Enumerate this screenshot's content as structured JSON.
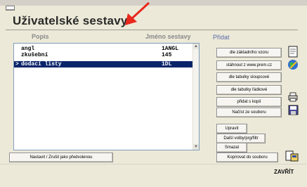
{
  "window": {
    "title": "Uživatelské sestavy"
  },
  "list": {
    "col_popis": "Popis",
    "col_jmeno": "Jméno sestavy",
    "rows": [
      {
        "marker": "",
        "name": "angl",
        "code": "1ANGL",
        "selected": false
      },
      {
        "marker": "",
        "name": "zkušební",
        "code": "145",
        "selected": false
      },
      {
        "marker": ">",
        "name": "dodací listy",
        "code": "1DL",
        "selected": true
      }
    ]
  },
  "add_panel": {
    "label": "Přidat",
    "buttons": {
      "from_template": "dle základního vzoru",
      "download": "stáhnout z www.prem.cz",
      "by_column_table": "dle tabulky sloupcové",
      "by_row_table": "dle tabulky řádkové",
      "add_copy": "přidat s kopií",
      "load_file": "Načíst ze souboru"
    }
  },
  "edit_panel": {
    "buttons": {
      "edit": "Upravit",
      "more_options": "Další volby/prg/filtr",
      "delete": "Smazat",
      "copy_to_file": "Kopírovat do souboru"
    }
  },
  "footer": {
    "set_default": "Nastavit / Zrušit  jako předvolenou",
    "close": "ZAVŘÍT"
  },
  "colors": {
    "window_bg": "#ece9d8",
    "selection": "#0a246a",
    "arrow": "#e8281d",
    "accent_label": "#5a6aa8"
  },
  "icons": [
    "arrow-annotation",
    "document-icon",
    "globe-download-icon",
    "printer-icon",
    "floppy-disk-icon",
    "copy-file-icon"
  ]
}
